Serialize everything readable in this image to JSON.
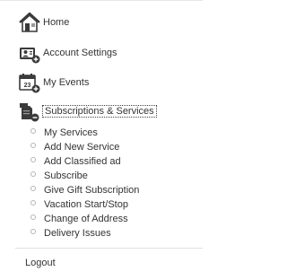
{
  "menu": {
    "home": {
      "label": "Home",
      "icon": "house-icon"
    },
    "account_settings": {
      "label": "Account Settings",
      "icon": "account-settings-icon"
    },
    "my_events": {
      "label": "My Events",
      "icon": "calendar-icon",
      "calendar_day": "23"
    },
    "subscriptions": {
      "label": "Subscriptions & Services",
      "icon": "subscriptions-icon",
      "expanded": true
    }
  },
  "submenu": {
    "items": [
      {
        "label": "My Services"
      },
      {
        "label": "Add New Service"
      },
      {
        "label": "Add Classified ad"
      },
      {
        "label": "Subscribe"
      },
      {
        "label": "Give Gift Subscription"
      },
      {
        "label": "Vacation Start/Stop"
      },
      {
        "label": "Change of Address"
      },
      {
        "label": "Delivery Issues"
      }
    ]
  },
  "footer": {
    "logout_label": "Logout"
  },
  "colors": {
    "text": "#333333",
    "icon_dark": "#3a3a3a",
    "divider": "#e0e0e0",
    "bullet_border": "#b5b5b5"
  }
}
